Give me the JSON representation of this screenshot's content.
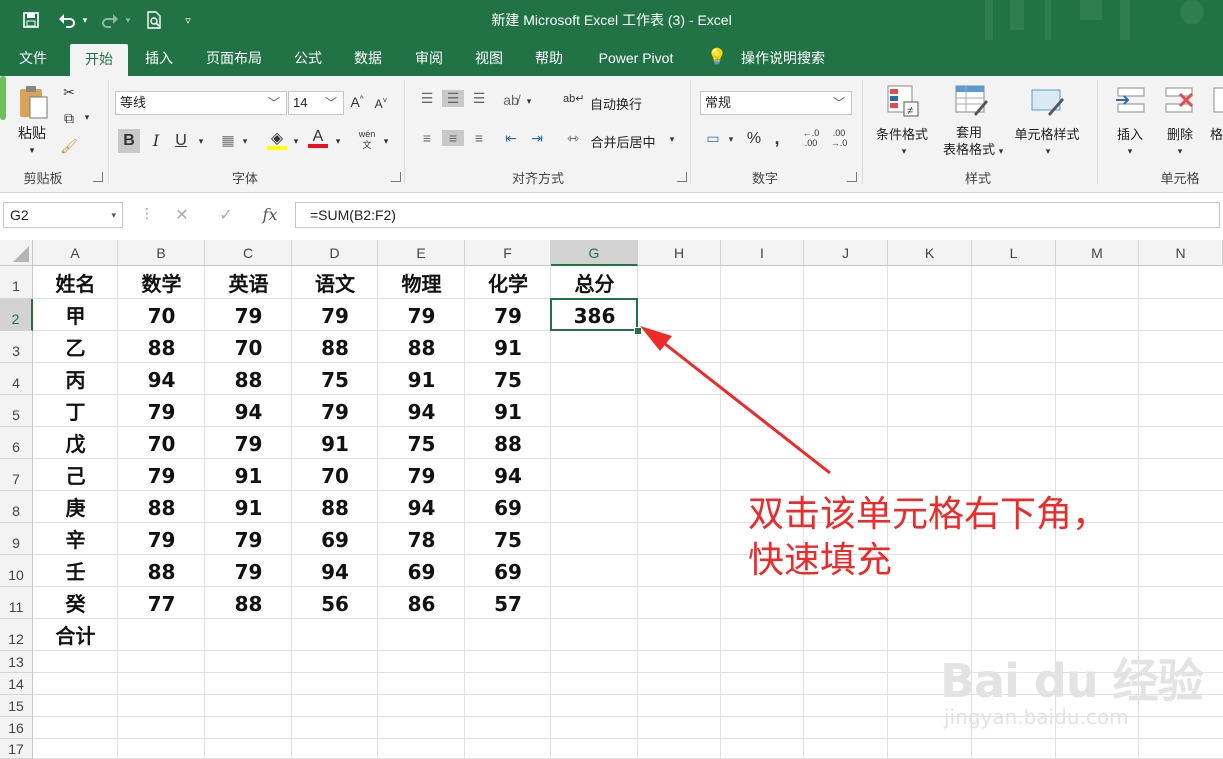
{
  "window": {
    "title": "新建 Microsoft Excel 工作表 (3)  -  Excel"
  },
  "quick_access": {
    "save_icon": "save-icon",
    "undo_icon": "undo-icon",
    "redo_icon": "redo-icon",
    "preview_icon": "print-preview-icon",
    "customize_icon": "customize-icon"
  },
  "tabs": [
    {
      "label": "文件"
    },
    {
      "label": "开始"
    },
    {
      "label": "插入"
    },
    {
      "label": "页面布局"
    },
    {
      "label": "公式"
    },
    {
      "label": "数据"
    },
    {
      "label": "审阅"
    },
    {
      "label": "视图"
    },
    {
      "label": "帮助"
    },
    {
      "label": "Power Pivot"
    },
    {
      "label": "操作说明搜索"
    }
  ],
  "ribbon": {
    "clipboard": {
      "paste_label": "粘贴",
      "group_label": "剪贴板"
    },
    "font": {
      "font_name": "等线",
      "font_size": "14",
      "bold": "B",
      "italic": "I",
      "underline": "U",
      "font_color_label": "A",
      "wen": "wén\n文",
      "group_label": "字体"
    },
    "alignment": {
      "wrap_label": "自动换行",
      "merge_label": "合并后居中",
      "group_label": "对齐方式"
    },
    "number": {
      "format": "常规",
      "percent": "%",
      "comma": ",",
      "group_label": "数字"
    },
    "styles": {
      "cond_format": "条件格式",
      "table_format": "套用\n表格格式",
      "cell_style": "单元格样式",
      "group_label": "样式"
    },
    "cells": {
      "insert": "插入",
      "delete": "删除",
      "format": "格",
      "group_label": "单元格"
    }
  },
  "formula_bar": {
    "name_box": "G2",
    "cancel": "✕",
    "enter": "✓",
    "fx": "fx",
    "formula": "=SUM(B2:F2)"
  },
  "columns": [
    "A",
    "B",
    "C",
    "D",
    "E",
    "F",
    "G",
    "H",
    "I",
    "J",
    "K",
    "L",
    "M",
    "N"
  ],
  "rows": [
    "1",
    "2",
    "3",
    "4",
    "5",
    "6",
    "7",
    "8",
    "9",
    "10",
    "11",
    "12",
    "13",
    "14",
    "15",
    "16",
    "17"
  ],
  "sheet": {
    "header": [
      "姓名",
      "数学",
      "英语",
      "语文",
      "物理",
      "化学",
      "总分"
    ],
    "data": [
      [
        "甲",
        "70",
        "79",
        "79",
        "79",
        "79",
        "386"
      ],
      [
        "乙",
        "88",
        "70",
        "88",
        "88",
        "91",
        ""
      ],
      [
        "丙",
        "94",
        "88",
        "75",
        "91",
        "75",
        ""
      ],
      [
        "丁",
        "79",
        "94",
        "79",
        "94",
        "91",
        ""
      ],
      [
        "戊",
        "70",
        "79",
        "91",
        "75",
        "88",
        ""
      ],
      [
        "己",
        "79",
        "91",
        "70",
        "79",
        "94",
        ""
      ],
      [
        "庚",
        "88",
        "91",
        "88",
        "94",
        "69",
        ""
      ],
      [
        "辛",
        "79",
        "79",
        "69",
        "78",
        "75",
        ""
      ],
      [
        "壬",
        "88",
        "79",
        "94",
        "69",
        "69",
        ""
      ],
      [
        "癸",
        "77",
        "88",
        "56",
        "86",
        "57",
        ""
      ],
      [
        "合计",
        "",
        "",
        "",
        "",
        "",
        ""
      ]
    ]
  },
  "selected_cell": "G2",
  "annotation": {
    "line1": "双击该单元格右下角，",
    "line2": "快速填充",
    "color": "#ee2a2a"
  },
  "watermark": {
    "logo": "Bai du 经验",
    "url": "jingyan.baidu.com"
  }
}
